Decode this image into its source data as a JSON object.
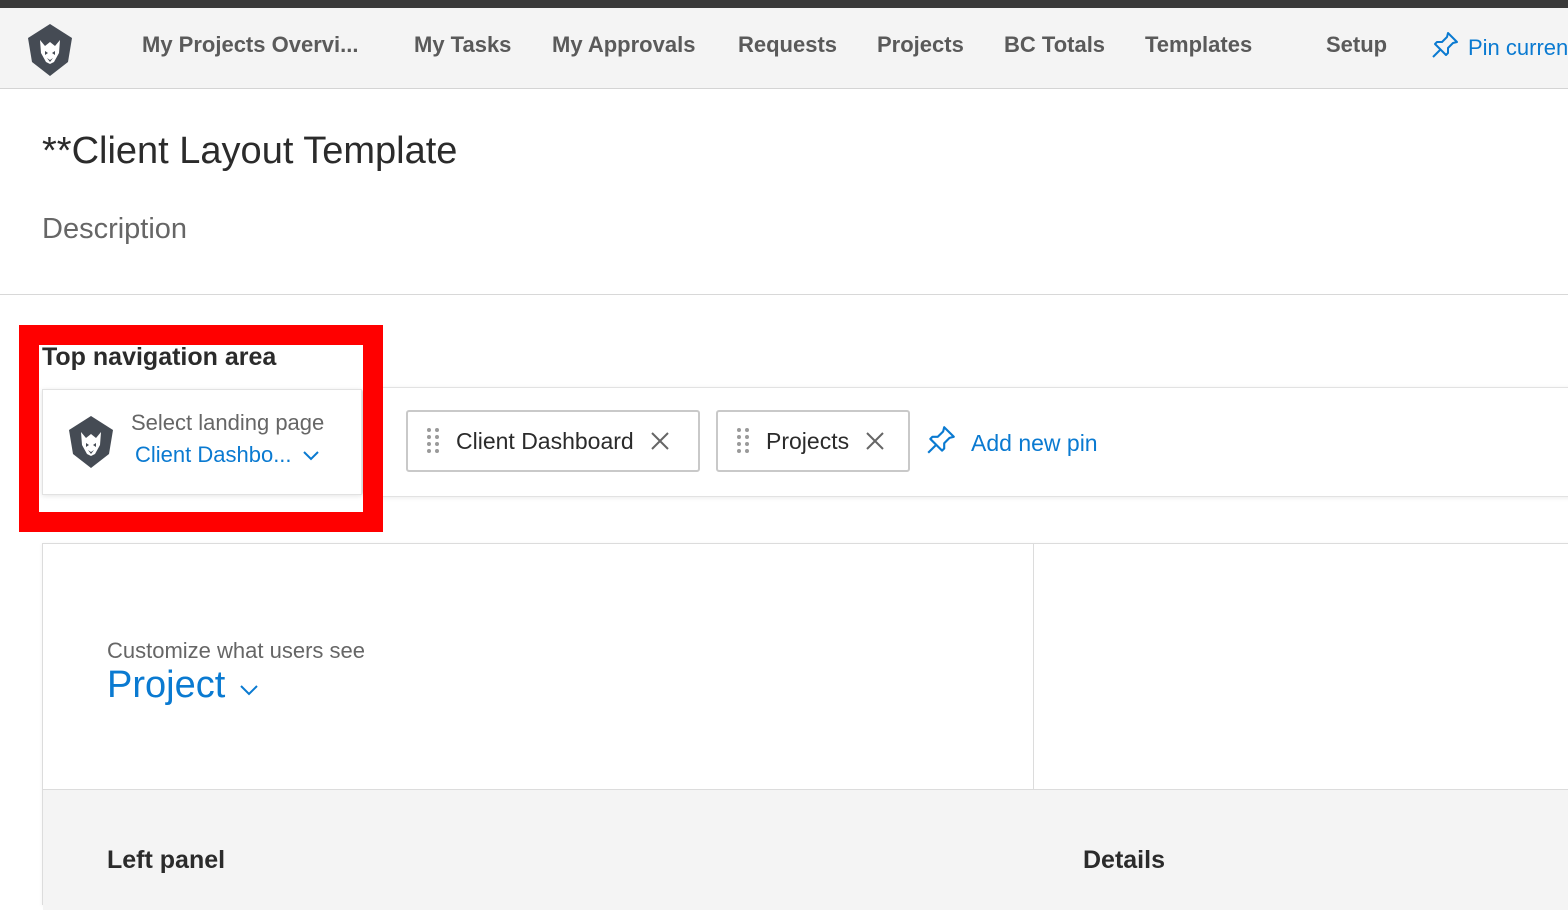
{
  "nav": {
    "items": [
      {
        "label": "My Projects Overvi..."
      },
      {
        "label": "My Tasks"
      },
      {
        "label": "My Approvals"
      },
      {
        "label": "Requests"
      },
      {
        "label": "Projects"
      },
      {
        "label": "BC Totals"
      },
      {
        "label": "Templates"
      },
      {
        "label": "Setup"
      }
    ],
    "pin_current": "Pin curren"
  },
  "page": {
    "title": "**Client Layout Template",
    "description": "Description"
  },
  "top_nav_area": {
    "section_label": "Top navigation area",
    "landing": {
      "caption": "Select landing page",
      "value": "Client Dashbo..."
    },
    "pins": [
      {
        "label": "Client Dashboard"
      },
      {
        "label": "Projects"
      }
    ],
    "add_pin": "Add new pin"
  },
  "layout_panel": {
    "customize_caption": "Customize what users see",
    "customize_value": "Project",
    "left_panel_label": "Left panel",
    "details_label": "Details"
  },
  "colors": {
    "accent": "#0a7ad1",
    "highlight": "#ff0000",
    "logo": "#454b54"
  },
  "icons": [
    "lion-logo-icon",
    "pin-icon",
    "chevron-down-icon",
    "drag-handle-icon",
    "close-icon"
  ]
}
